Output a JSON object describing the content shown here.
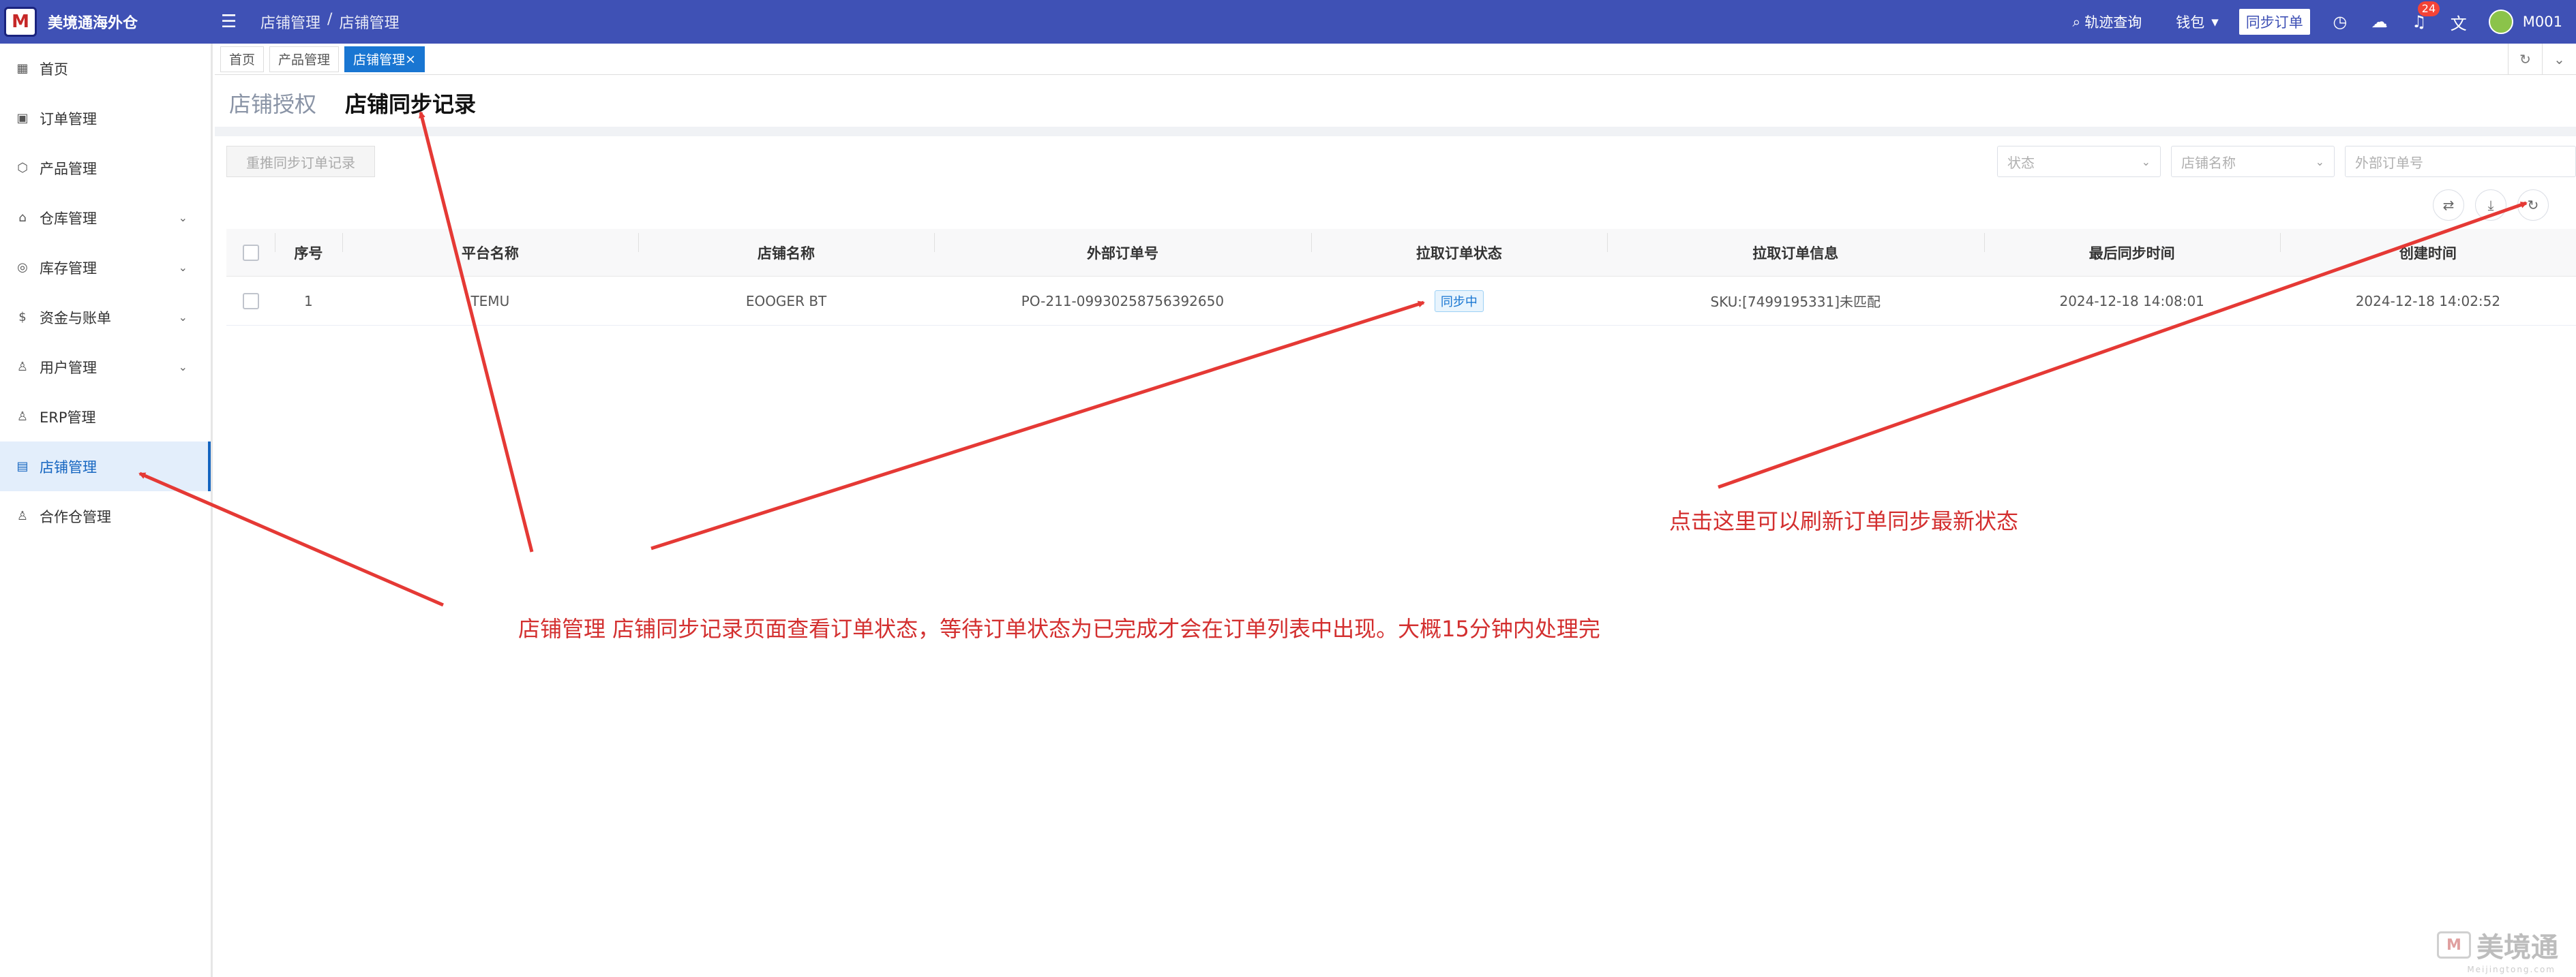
{
  "app": {
    "logo": "M",
    "name": "美境通海外仓"
  },
  "breadcrumb": [
    "店铺管理",
    "/",
    "店铺管理"
  ],
  "topbar": {
    "track": "轨迹查询",
    "wallet": "钱包",
    "sync_orders": "同步订单",
    "notifications": "24",
    "user": "M001"
  },
  "sidebar": [
    {
      "label": "首页",
      "icon": "grid-icon",
      "expand": false
    },
    {
      "label": "订单管理",
      "icon": "order-icon",
      "expand": false
    },
    {
      "label": "产品管理",
      "icon": "box-icon",
      "expand": false
    },
    {
      "label": "仓库管理",
      "icon": "warehouse-icon",
      "expand": true
    },
    {
      "label": "库存管理",
      "icon": "inventory-icon",
      "expand": true
    },
    {
      "label": "资金与账单",
      "icon": "money-icon",
      "expand": true
    },
    {
      "label": "用户管理",
      "icon": "user-icon",
      "expand": true
    },
    {
      "label": "ERP管理",
      "icon": "user-icon",
      "expand": false
    },
    {
      "label": "店铺管理",
      "icon": "store-icon",
      "expand": false,
      "active": true
    },
    {
      "label": "合作仓管理",
      "icon": "user-icon",
      "expand": false
    }
  ],
  "tabs": [
    {
      "label": "首页"
    },
    {
      "label": "产品管理"
    },
    {
      "label": "店铺管理",
      "active": true,
      "close": "×"
    }
  ],
  "page_tabs": [
    {
      "label": "店铺授权"
    },
    {
      "label": "店铺同步记录",
      "active": true
    }
  ],
  "toolbar": {
    "rebuild": "重推同步订单记录",
    "status_placeholder": "状态",
    "store_placeholder": "店铺名称",
    "order_placeholder": "外部订单号"
  },
  "table": {
    "headers": [
      "序号",
      "平台名称",
      "店铺名称",
      "外部订单号",
      "拉取订单状态",
      "拉取订单信息",
      "最后同步时间",
      "创建时间"
    ],
    "rows": [
      [
        "1",
        "TEMU",
        "EOOGER BT",
        "PO-211-09930258756392650",
        "同步中",
        "SKU:[7499195331]未匹配",
        "2024-12-18 14:08:01",
        "2024-12-18 14:02:52"
      ]
    ]
  },
  "annotations": {
    "main": "店铺管理 店铺同步记录页面查看订单状态，等待订单状态为已完成才会在订单列表中出现。大概15分钟内处理完",
    "refresh": "点击这里可以刷新订单同步最新状态",
    "color": "#d32f2f"
  },
  "watermark": {
    "text": "美境通",
    "sub": "Meijingtong.com"
  },
  "colors": {
    "header": "#3f51b5",
    "active": "#1565c0",
    "tag": "#1976d2"
  }
}
